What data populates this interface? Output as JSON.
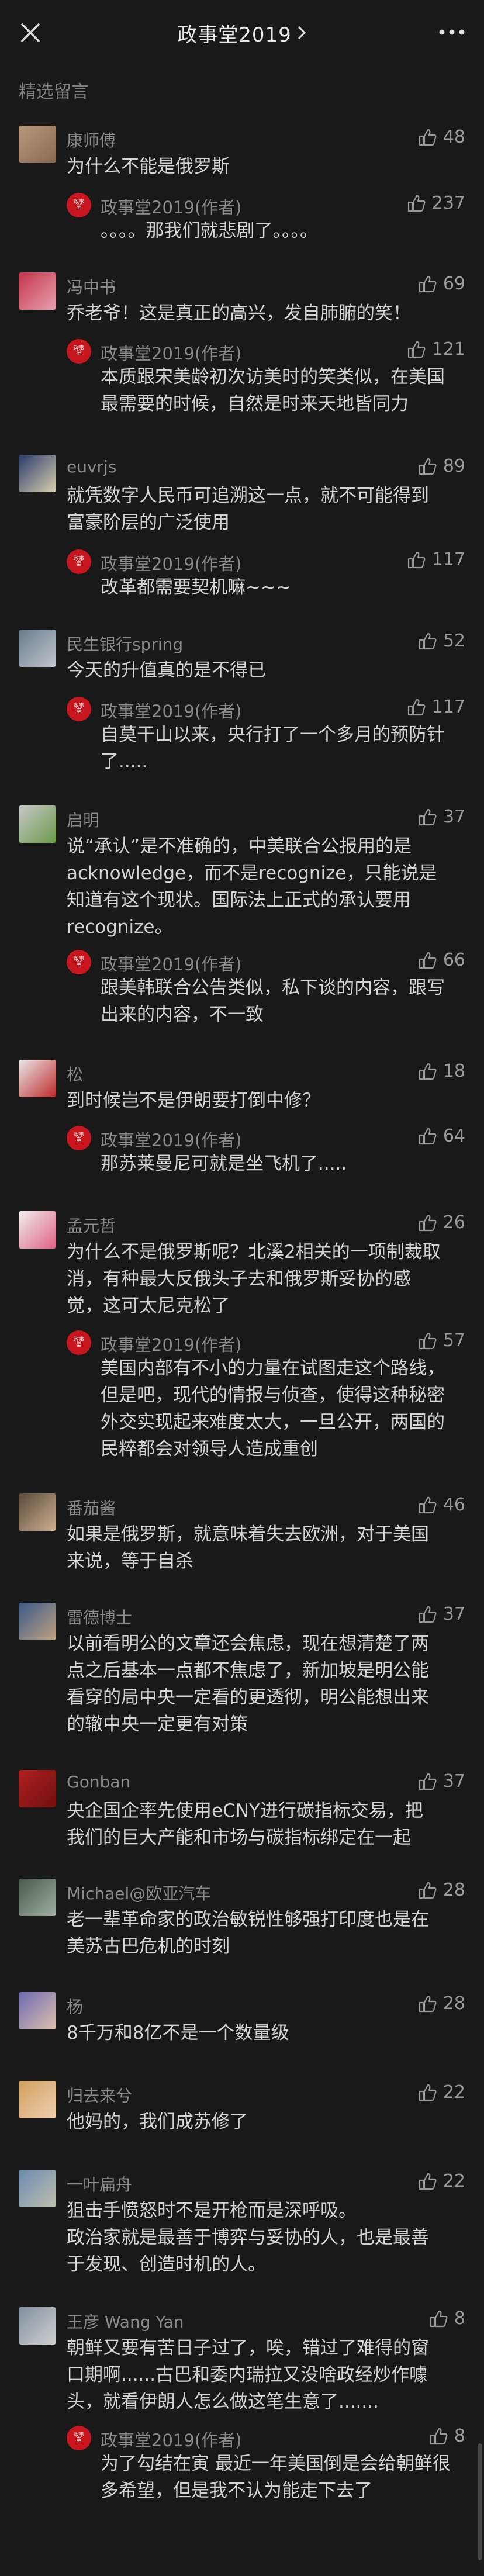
{
  "header": {
    "title": "政事堂2019",
    "close_icon": "close-icon",
    "more_icon": "more-icon"
  },
  "section_label": "精选留言",
  "colors": {
    "background": "#191919",
    "reply_badge": "#c8161e",
    "text": "#d4d4d4",
    "muted": "#8a8a8a"
  },
  "comments": [
    {
      "user": "康师傅",
      "likes": "48",
      "text": "为什么不能是俄罗斯",
      "reply": {
        "author": "政事堂2019(作者)",
        "likes": "237",
        "text": "。。。。那我们就悲剧了。。。。"
      }
    },
    {
      "user": "冯中书",
      "likes": "69",
      "text": "乔老爷！这是真正的高兴，发自肺腑的笑！",
      "reply": {
        "author": "政事堂2019(作者)",
        "likes": "121",
        "text": "本质跟宋美龄初次访美时的笑类似，在美国最需要的时候，自然是时来天地皆同力"
      }
    },
    {
      "user": "euvrjs",
      "likes": "89",
      "text": "就凭数字人民币可追溯这一点，就不可能得到富豪阶层的广泛使用",
      "reply": {
        "author": "政事堂2019(作者)",
        "likes": "117",
        "text": "改革都需要契机嘛~~~"
      }
    },
    {
      "user": "民生银行spring",
      "likes": "52",
      "text": "今天的升值真的是不得已",
      "reply": {
        "author": "政事堂2019(作者)",
        "likes": "117",
        "text": "自莫干山以来，央行打了一个多月的预防针了....."
      }
    },
    {
      "user": "启明",
      "likes": "37",
      "text": "说“承认”是不准确的，中美联合公报用的是acknowledge，而不是recognize，只能说是知道有这个现状。国际法上正式的承认要用recognize。",
      "reply": {
        "author": "政事堂2019(作者)",
        "likes": "66",
        "text": "跟美韩联合公告类似，私下谈的内容，跟写出来的内容，不一致"
      }
    },
    {
      "user": "松",
      "likes": "18",
      "text": "到时候岂不是伊朗要打倒中修？",
      "reply": {
        "author": "政事堂2019(作者)",
        "likes": "64",
        "text": "那苏莱曼尼可就是坐飞机了....."
      }
    },
    {
      "user": "孟元哲",
      "likes": "26",
      "text": "为什么不是俄罗斯呢？北溪2相关的一项制裁取消，有种最大反俄头子去和俄罗斯妥协的感觉，这可太尼克松了",
      "reply": {
        "author": "政事堂2019(作者)",
        "likes": "57",
        "text": "美国内部有不小的力量在试图走这个路线，但是吧，现代的情报与侦查，使得这种秘密外交实现起来难度太大，一旦公开，两国的民粹都会对领导人造成重创"
      }
    },
    {
      "user": "番茄酱",
      "likes": "46",
      "text": "如果是俄罗斯，就意味着失去欧洲，对于美国来说，等于自杀"
    },
    {
      "user": "雷德博士",
      "likes": "37",
      "text": "以前看明公的文章还会焦虑，现在想清楚了两点之后基本一点都不焦虑了，新加坡是明公能看穿的局中央一定看的更透彻，明公能想出来的辙中央一定更有对策"
    },
    {
      "user": "Gonban",
      "likes": "37",
      "text": "央企国企率先使用eCNY进行碳指标交易，把我们的巨大产能和市场与碳指标绑定在一起"
    },
    {
      "user": "Michael@欧亚汽车",
      "likes": "28",
      "text": "老一辈革命家的政治敏锐性够强打印度也是在美苏古巴危机的时刻"
    },
    {
      "user": "杨",
      "likes": "28",
      "text": "8千万和8亿不是一个数量级"
    },
    {
      "user": "归去来兮",
      "likes": "22",
      "text": "他妈的，我们成苏修了"
    },
    {
      "user": "一叶扁舟",
      "likes": "22",
      "text": "狙击手愤怒时不是开枪而是深呼吸。\n政治家就是最善于博弈与妥协的人，也是最善于发现、创造时机的人。"
    },
    {
      "user": "王彦 Wang Yan",
      "likes": "8",
      "text": "朝鲜又要有苦日子过了，唉，错过了难得的窗口期啊......古巴和委内瑞拉又没啥政经炒作噱头，就看伊朗人怎么做这笔生意了.......",
      "reply": {
        "author": "政事堂2019(作者)",
        "likes": "8",
        "text": "为了勾结在寅 最近一年美国倒是会给朝鲜很多希望，但是我不认为能走下去了"
      }
    }
  ]
}
